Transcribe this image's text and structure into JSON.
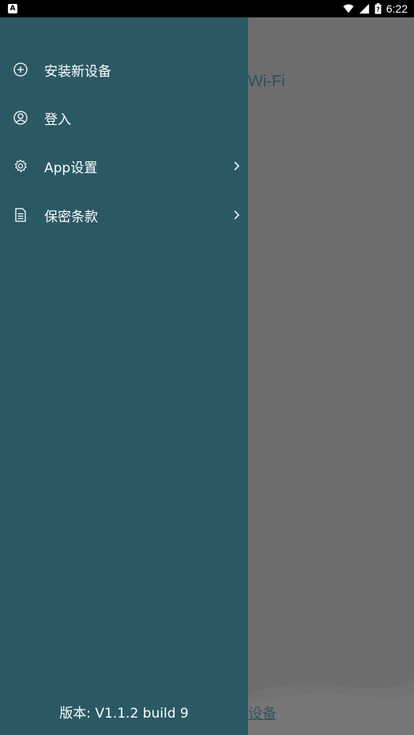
{
  "status_bar": {
    "time": "6:22",
    "left_badge": "A",
    "icons": [
      "wifi-icon",
      "signal-icon",
      "battery-icon"
    ]
  },
  "background": {
    "wifi_text": "Wi-Fi",
    "link_text": "设备"
  },
  "drawer": {
    "items": [
      {
        "label": "安装新设备",
        "icon": "add-circle-icon",
        "chevron": false
      },
      {
        "label": "登入",
        "icon": "user-icon",
        "chevron": false
      },
      {
        "label": "App设置",
        "icon": "gear-icon",
        "chevron": true
      },
      {
        "label": "保密条款",
        "icon": "document-icon",
        "chevron": true
      }
    ],
    "version": "版本: V1.1.2 build 9"
  },
  "colors": {
    "drawer_bg": "#2a5964",
    "scrim": "#6a6a6a",
    "text": "#ffffff"
  }
}
